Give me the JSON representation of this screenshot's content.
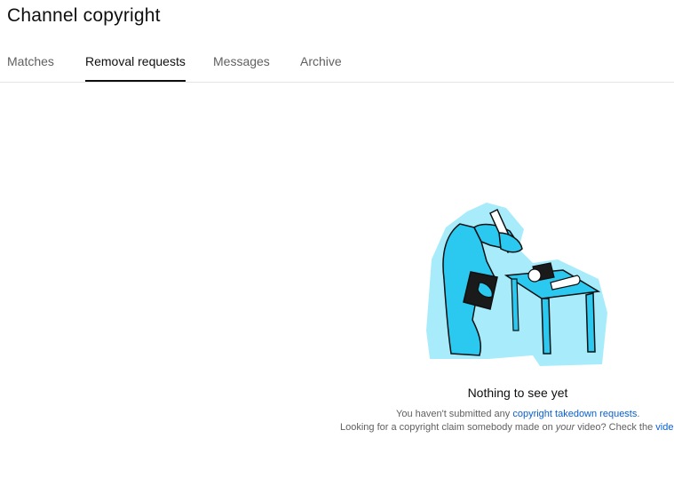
{
  "page": {
    "title": "Channel copyright"
  },
  "tabs": [
    {
      "label": "Matches",
      "active": false
    },
    {
      "label": "Removal requests",
      "active": true
    },
    {
      "label": "Messages",
      "active": false
    },
    {
      "label": "Archive",
      "active": false
    }
  ],
  "empty_state": {
    "heading": "Nothing to see yet",
    "line1_prefix": "You haven't submitted any ",
    "line1_link": "copyright takedown requests",
    "line1_suffix": ".",
    "line2_prefix": "Looking for a copyright claim somebody made on ",
    "line2_emphasis": "your",
    "line2_middle": " video? Check the ",
    "line2_link": "video"
  },
  "colors": {
    "illustration_fill": "#2bc8f0",
    "illustration_halo": "#a8ecfb",
    "link": "#065fd4"
  }
}
